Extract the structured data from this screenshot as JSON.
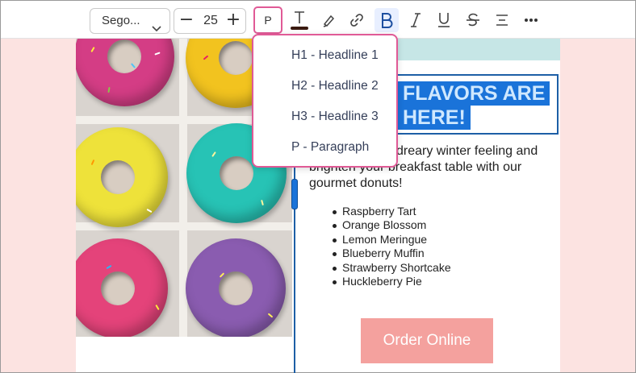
{
  "toolbar": {
    "font_family": "Sego...",
    "font_size": "25",
    "decrease_label": "−",
    "increase_label": "+",
    "paragraph_style": "P",
    "icons": [
      "text-color-icon",
      "highlighter-icon",
      "link-icon",
      "bold-icon",
      "italic-icon",
      "underline-icon",
      "strikethrough-icon",
      "align-icon",
      "more-icon"
    ],
    "text_color": "#3a1a10",
    "active_format": "bold"
  },
  "dropdown": {
    "items": [
      {
        "label": "H1 - Headline 1"
      },
      {
        "label": "H2 - Headline 2"
      },
      {
        "label": "H3 - Headline 3"
      },
      {
        "label": "P - Paragraph"
      }
    ]
  },
  "email": {
    "headline_line1": "FLAVORS ARE",
    "headline_line2": "HERE!",
    "body_line1": "dreary winter feeling and",
    "body_line2": "brighten your breakfast table with our",
    "body_line3": "gourmet donuts!",
    "flavors": [
      "Raspberry Tart",
      "Orange Blossom",
      "Lemon Meringue",
      "Blueberry Muffin",
      "Strawberry Shortcake",
      "Huckleberry Pie"
    ],
    "cta": "Order Online",
    "photo": "donut-photo"
  },
  "colors": {
    "accent": "#e05a96",
    "selection": "#1a73d9",
    "button": "#f4a19e",
    "background": "#fce3e1",
    "strip": "#c6e6e6"
  }
}
